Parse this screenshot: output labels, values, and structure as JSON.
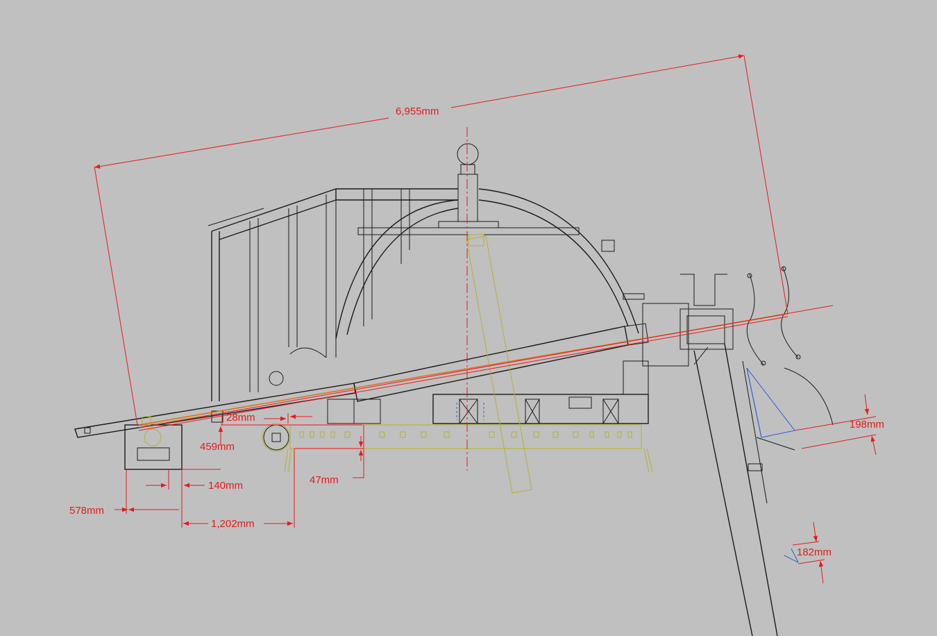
{
  "drawing": {
    "colors": {
      "background": "#c0c0c0",
      "linework": "#1a1a1a",
      "dimension": "#e8191b",
      "hidden": "#b5b036",
      "construction": "#2b5bd6",
      "axis": "#e06a10"
    },
    "dimensions": {
      "overall_length": "6,955mm",
      "offset_small": "28mm",
      "height_459": "459mm",
      "width_140": "140mm",
      "width_578": "578mm",
      "length_1202": "1,202mm",
      "depth_47": "47mm",
      "right_198": "198mm",
      "bottom_182": "182mm"
    }
  }
}
